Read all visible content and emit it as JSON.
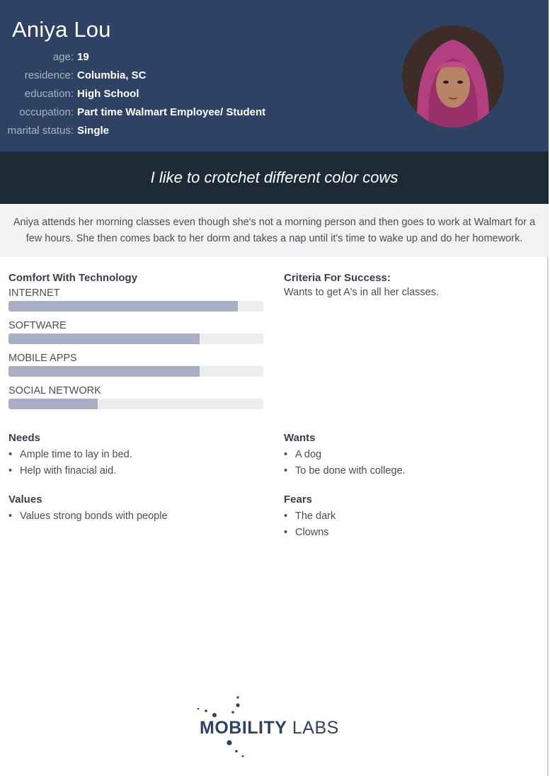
{
  "persona": {
    "name": "Aniya Lou",
    "facts": [
      {
        "label": "age:",
        "value": "19"
      },
      {
        "label": "residence:",
        "value": "Columbia, SC"
      },
      {
        "label": "education:",
        "value": "High School"
      },
      {
        "label": "occupation:",
        "value": "Part time Walmart Employee/ Student"
      },
      {
        "label": "marital status:",
        "value": "Single"
      }
    ],
    "quote": "I like to crotchet different color cows",
    "bio": "Aniya attends her morning classes even though she's not a morning person and then goes to work at Walmart for a few hours. She then comes back to her dorm and takes a nap until it's time to wake up and do her homework."
  },
  "technology": {
    "title": "Comfort With Technology",
    "meters": [
      {
        "label": "INTERNET",
        "level": 0.9
      },
      {
        "label": "SOFTWARE",
        "level": 0.75
      },
      {
        "label": "MOBILE APPS",
        "level": 0.75
      },
      {
        "label": "SOCIAL NETWORK",
        "level": 0.35
      }
    ],
    "fill_color": "#a9adc5",
    "track_color": "#ededee"
  },
  "criteria": {
    "title": "Criteria For Success:",
    "text": "Wants to get A's in all her classes."
  },
  "needs": {
    "title": "Needs",
    "items": [
      "Ample time to lay in bed.",
      "Help with finacial aid."
    ]
  },
  "wants": {
    "title": "Wants",
    "items": [
      "A dog",
      "To be done with college."
    ]
  },
  "values": {
    "title": "Values",
    "items": [
      "Values strong bonds with people"
    ]
  },
  "fears": {
    "title": "Fears",
    "items": [
      "The dark",
      "Clowns"
    ]
  },
  "logo": {
    "brand_bold": "MOBILITY",
    "brand_light": " LABS",
    "color": "#2e4263"
  },
  "colors": {
    "header_bg": "#2e4263",
    "quote_bg": "#1f2a39",
    "bio_bg": "#f2f2f2"
  }
}
